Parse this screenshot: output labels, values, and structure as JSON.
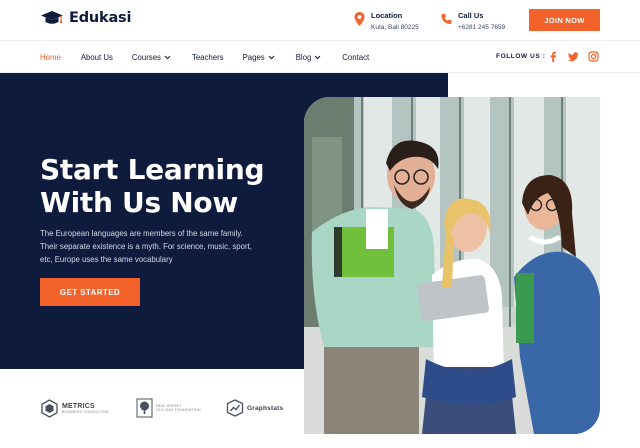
{
  "brand": {
    "name": "Edukasi"
  },
  "header": {
    "location": {
      "title": "Location",
      "value": "Kuta, Bali 80225",
      "icon": "map-pin-icon"
    },
    "call": {
      "title": "Call Us",
      "value": "+6281 245 7659",
      "icon": "phone-icon"
    },
    "join_label": "JOIN NOW"
  },
  "nav": {
    "items": [
      {
        "label": "Home",
        "active": true
      },
      {
        "label": "About Us"
      },
      {
        "label": "Courses",
        "dropdown": true
      },
      {
        "label": "Teachers"
      },
      {
        "label": "Pages",
        "dropdown": true
      },
      {
        "label": "Blog",
        "dropdown": true
      },
      {
        "label": "Contact"
      }
    ],
    "follow_label": "FOLLOW US :",
    "social": [
      "facebook-icon",
      "twitter-icon",
      "instagram-icon"
    ]
  },
  "hero": {
    "title_line1": "Start Learning",
    "title_line2": "With Us Now",
    "description": "The European languages are members of the same family. Their separate existence is a myth. For science, music, sport, etc, Europe uses the same vocabulary",
    "cta_label": "GET STARTED"
  },
  "partners": [
    {
      "name": "METRICS",
      "tagline": "BUSINESS CONSULTING"
    },
    {
      "name": "NEW JERSEY",
      "tagline": "OLD OAK FOUNDATION"
    },
    {
      "name": "Graphstats",
      "tagline": ""
    }
  ],
  "colors": {
    "accent": "#f4622b",
    "navy": "#0e1b3d"
  }
}
